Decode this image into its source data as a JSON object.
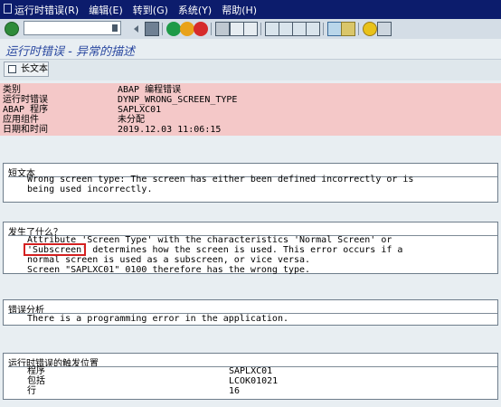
{
  "menu": [
    "运行时错误(R)",
    "编辑(E)",
    "转到(G)",
    "系统(Y)",
    "帮助(H)"
  ],
  "title": "运行时错误 - 异常的描述",
  "longtext_button": "长文本",
  "header": {
    "rows": [
      {
        "label": "类别",
        "value": "ABAP 编程错误"
      },
      {
        "label": "运行时错误",
        "value": "DYNP_WRONG_SCREEN_TYPE"
      },
      {
        "label": "ABAP 程序",
        "value": "SAPLXC01"
      },
      {
        "label": "应用组件",
        "value": "未分配"
      },
      {
        "label": "日期和时间",
        "value": "2019.12.03 11:06:15"
      }
    ]
  },
  "short_text": {
    "heading": "短文本",
    "lines": [
      "Wrong screen type: The screen has either been defined incorrectly or is",
      "being used incorrectly."
    ]
  },
  "what_happened": {
    "heading": "发生了什么？",
    "line1": "Attribute 'Screen Type' with the characteristics 'Normal Screen' or",
    "line2_a": "'Subscreen'",
    "line2_b": " determines how the screen is used. This error occurs if a",
    "line3": "normal screen is used as a subscreen, or vice versa.",
    "line4": "Screen \"SAPLXC01\" 0100 therefore has the wrong type."
  },
  "error_analysis": {
    "heading": "错误分析",
    "line": "There is a programming error in the application."
  },
  "trigger": {
    "heading": "运行时错误的触发位置",
    "rows": [
      {
        "label": "程序",
        "value": "SAPLXC01"
      },
      {
        "label": "包括",
        "value": "LCOK01021"
      },
      {
        "label": "行",
        "value": "16"
      }
    ]
  },
  "colors": {
    "menubar": "#0c1c6c",
    "title": "#2a48a0",
    "header_bg": "#f4c8c8",
    "highlight": "#d42020"
  }
}
